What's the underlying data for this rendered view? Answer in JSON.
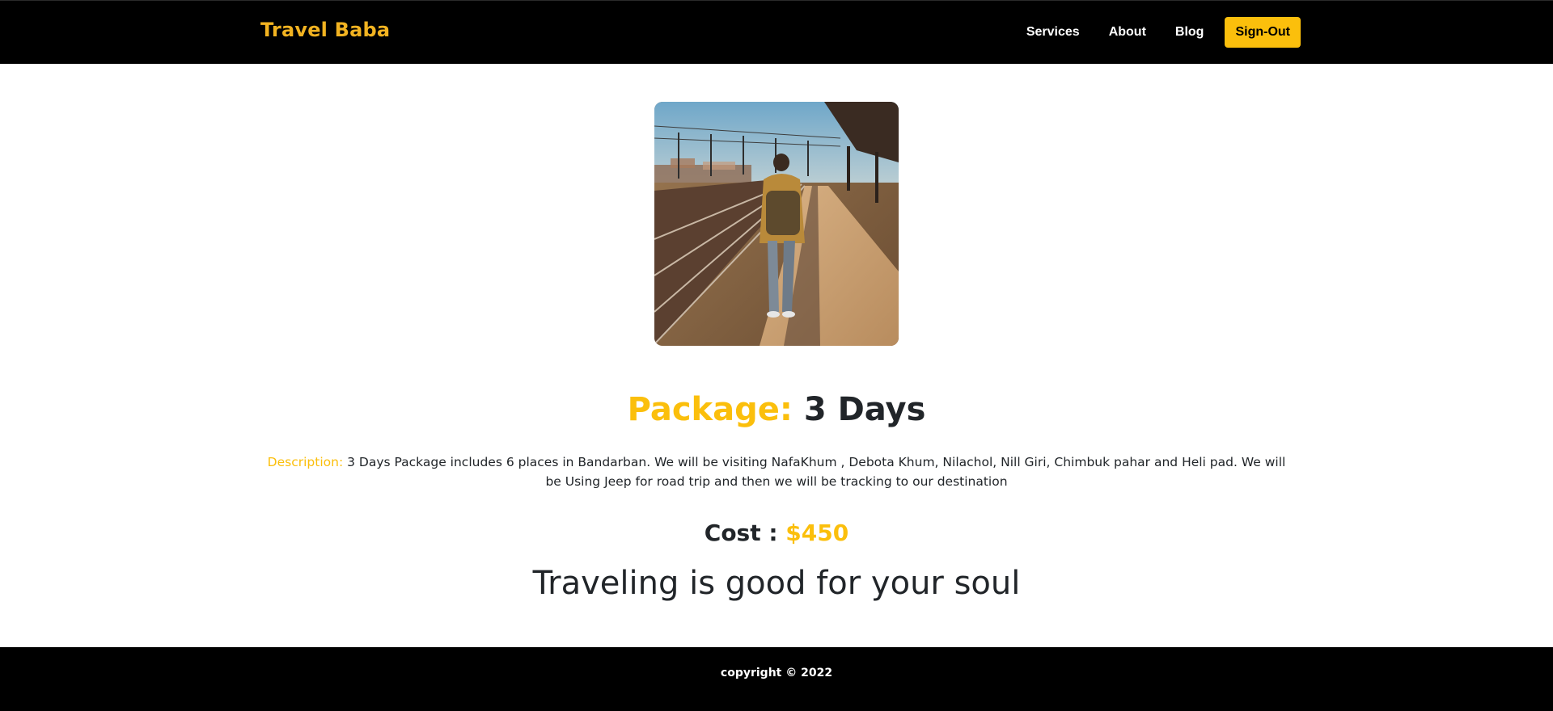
{
  "header": {
    "brand": "Travel Baba",
    "nav": [
      "Services",
      "About",
      "Blog"
    ],
    "signout_label": "Sign-Out"
  },
  "package": {
    "image_icon": "traveler-photo-icon",
    "title_label": "Package:",
    "title_value": "3 Days",
    "description_label": "Description:",
    "description_text": "3 Days Package includes 6 places in Bandarban. We will be visiting NafaKhum , Debota Khum, Nilachol, Nill Giri, Chimbuk pahar and Heli pad. We will be Using Jeep for road trip and then we will be tracking to our destination",
    "cost_label": "Cost :",
    "cost_value": "$450",
    "tagline": "Traveling is good for your soul"
  },
  "footer": {
    "copyright": "copyright © 2022"
  },
  "colors": {
    "accent": "#fbbf0c",
    "brand": "#f2b321",
    "bar_bg": "#000000",
    "text": "#212529"
  }
}
